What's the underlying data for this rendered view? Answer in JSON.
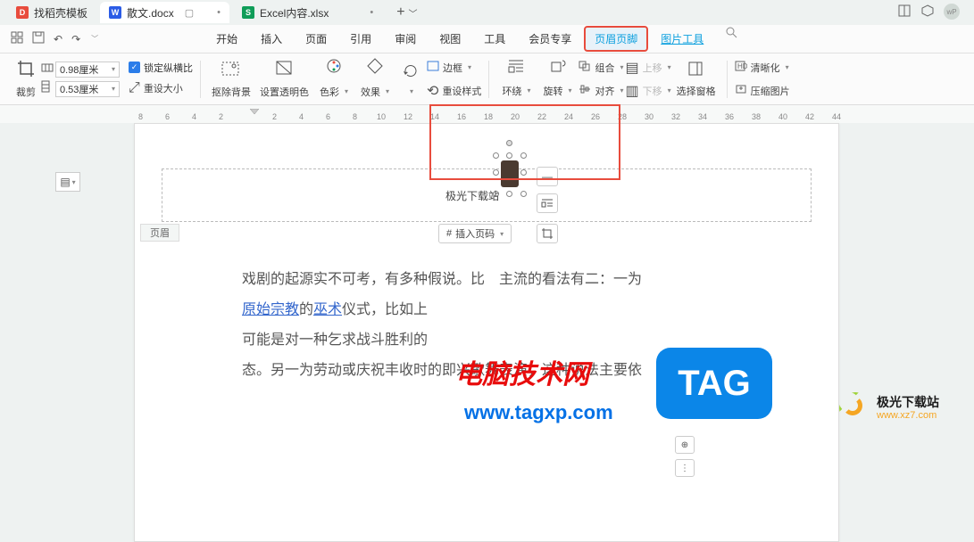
{
  "tabs": [
    {
      "icon": "D",
      "label": "找稻壳模板"
    },
    {
      "icon": "W",
      "label": "散文.docx"
    },
    {
      "icon": "S",
      "label": "Excel内容.xlsx"
    }
  ],
  "menu": {
    "items": [
      "开始",
      "插入",
      "页面",
      "引用",
      "审阅",
      "视图",
      "工具",
      "会员专享"
    ],
    "highlighted": "页眉页脚",
    "link": "图片工具"
  },
  "ribbon": {
    "crop": "裁剪",
    "width": "0.98厘米",
    "height": "0.53厘米",
    "lock": "锁定纵横比",
    "reset_size": "重设大小",
    "remove_bg": "抠除背景",
    "set_transparent": "设置透明色",
    "color": "色彩",
    "effect": "效果",
    "border": "边框",
    "reset_style": "重设样式",
    "wrap": "环绕",
    "rotate": "旋转",
    "group": "组合",
    "align": "对齐",
    "move_up": "上移",
    "move_down": "下移",
    "selection_pane": "选择窗格",
    "clarity": "清晰化",
    "compress": "压缩图片"
  },
  "header": {
    "text": "极光下载站",
    "tag": "页眉",
    "insert_page": "插入页码"
  },
  "body": {
    "line1_a": "戏剧的起源实不可考，有多种假说。比",
    "line1_b": "主流的看法有二：一为",
    "line2_link1": "原始宗教",
    "line2_mid": "的",
    "line2_link2": "巫术",
    "line2_end": "仪式，比如上",
    "line3": "可能是对一种乞求战斗胜利的",
    "line4": "态。另一为劳动或庆祝丰收时的即兴歌舞表演，这种说法主要依"
  },
  "overlay": {
    "red_text": "电脑技术网",
    "url": "www.tagxp.com",
    "tag": "TAG",
    "site_name": "极光下载站",
    "site_url": "www.xz7.com"
  }
}
